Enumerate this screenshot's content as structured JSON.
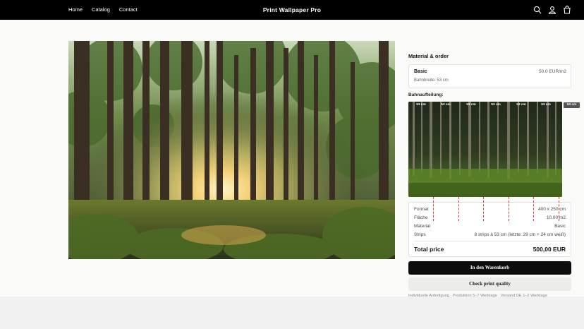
{
  "header": {
    "nav": [
      "Home",
      "Catalog",
      "Contact"
    ],
    "brand": "Print Wallpaper Pro",
    "icons": [
      "search-icon",
      "account-icon",
      "cart-icon"
    ]
  },
  "product": {
    "hero_alt_icon": "forest-sunlight-photo"
  },
  "panel": {
    "title": "Material & order",
    "material": {
      "name": "Basic",
      "price": "50.0 EUR/m2",
      "width": "Bahnbreite: 53 cm"
    },
    "bahn_label": "Bahnaufteilung:",
    "strip_labels": [
      "53 cm",
      "53 cm",
      "53 cm",
      "53 cm",
      "53 cm",
      "53 cm",
      "53 cm"
    ],
    "outside_label": "53 cm",
    "specs": [
      {
        "key": "Format",
        "value": "400 x 250 cm"
      },
      {
        "key": "Fläche",
        "value": "10.00 m2"
      },
      {
        "key": "Material",
        "value": "Basic"
      },
      {
        "key": "Strips",
        "value": "8 strips à 53 cm (letzte: 29 cm + 24 cm weiß)"
      }
    ],
    "total_label": "Total price",
    "total_value": "500,00 EUR",
    "cart_button": "In den Warenkorb",
    "check_button": "Check print quality",
    "note": "Individuelle Anfertigung · Produktion 5–7 Werktage · Versand DE 1–2 Werktage"
  },
  "colors": {
    "header_bg": "#000000",
    "cut_line": "#d23b3b",
    "button_dark": "#0d0d0d"
  }
}
